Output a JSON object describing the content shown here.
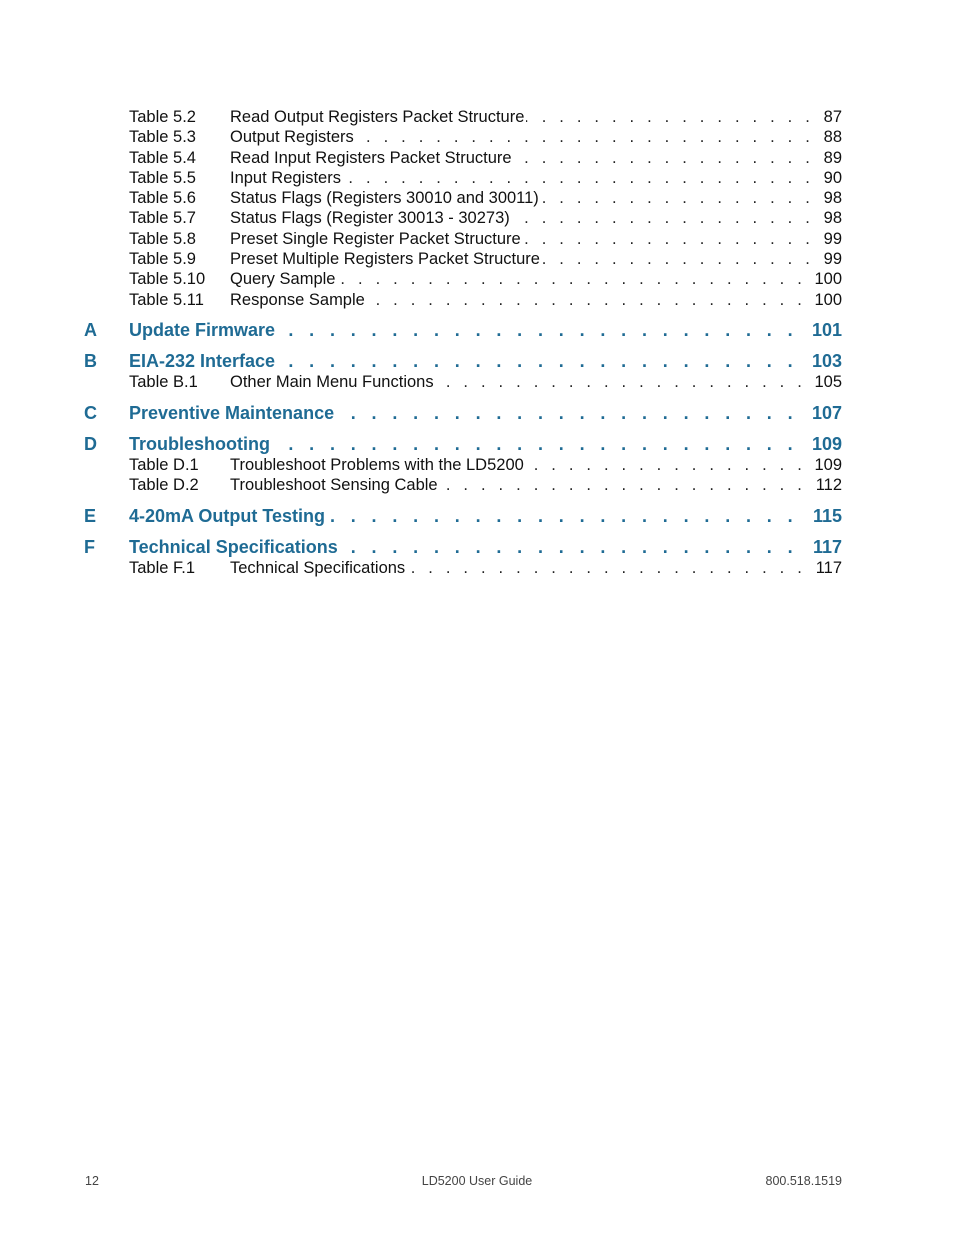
{
  "toc": {
    "entries": [
      {
        "kind": "table",
        "num": "Table 5.2",
        "title": "Read Output Registers Packet Structure",
        "page": "87"
      },
      {
        "kind": "table",
        "num": "Table 5.3",
        "title": "Output Registers",
        "page": "88"
      },
      {
        "kind": "table",
        "num": "Table 5.4",
        "title": "Read Input Registers Packet Structure",
        "page": "89"
      },
      {
        "kind": "table",
        "num": "Table 5.5",
        "title": "Input Registers",
        "page": "90"
      },
      {
        "kind": "table",
        "num": "Table 5.6",
        "title": "Status Flags (Registers 30010 and 30011)",
        "page": "98"
      },
      {
        "kind": "table",
        "num": "Table 5.7",
        "title": "Status Flags (Register 30013 - 30273)",
        "page": "98"
      },
      {
        "kind": "table",
        "num": "Table 5.8",
        "title": "Preset Single Register Packet Structure",
        "page": "99"
      },
      {
        "kind": "table",
        "num": "Table 5.9",
        "title": "Preset Multiple Registers Packet Structure",
        "page": "99"
      },
      {
        "kind": "table",
        "num": "Table 5.10",
        "title": "Query Sample",
        "page": "100"
      },
      {
        "kind": "table",
        "num": "Table 5.11",
        "title": "Response Sample",
        "page": "100"
      },
      {
        "kind": "appendix",
        "num": "A",
        "title": "Update Firmware",
        "page": "101"
      },
      {
        "kind": "appendix",
        "num": "B",
        "title": "EIA-232 Interface",
        "page": "103"
      },
      {
        "kind": "table",
        "num": "Table B.1",
        "title": "Other Main Menu Functions",
        "page": "105"
      },
      {
        "kind": "appendix",
        "num": "C",
        "title": "Preventive Maintenance",
        "page": "107"
      },
      {
        "kind": "appendix",
        "num": "D",
        "title": "Troubleshooting",
        "page": "109"
      },
      {
        "kind": "table",
        "num": "Table D.1",
        "title": "Troubleshoot Problems with the LD5200",
        "page": "109"
      },
      {
        "kind": "table",
        "num": "Table D.2",
        "title": "Troubleshoot Sensing Cable",
        "page": "112"
      },
      {
        "kind": "appendix",
        "num": "E",
        "title": "4-20mA Output Testing",
        "page": "115"
      },
      {
        "kind": "appendix",
        "num": "F",
        "title": "Technical Specifications",
        "page": "117"
      },
      {
        "kind": "table",
        "num": "Table F.1",
        "title": "Technical Specifications",
        "page": "117"
      }
    ]
  },
  "footer": {
    "page_number": "12",
    "document_title": "LD5200 User Guide",
    "phone": "800.518.1519"
  },
  "colors": {
    "appendix_heading": "#1f6b94",
    "body_text": "#111111"
  }
}
